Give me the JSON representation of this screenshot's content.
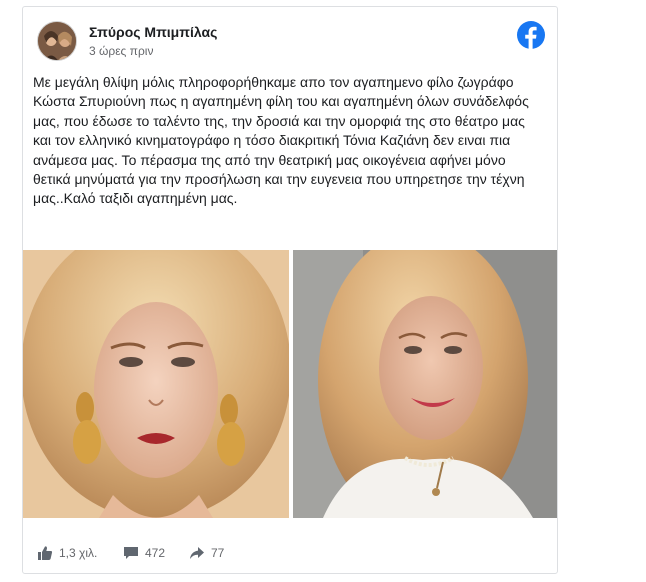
{
  "post": {
    "author": "Σπύρος Μπιμπίλας",
    "timestamp": "3 ώρες πριν",
    "text": "Με μεγάλη θλίψη μόλις πληροφορήθηκαμε απο τον αγαπημενο φίλο ζωγράφο Κώστα Σπυριούνη πως η αγαπημένη φίλη του και αγαπημένη όλων συνάδελφός μας, που έδωσε το ταλέντο της, την δροσιά και την ομορφιά της στο θέατρο μας και τον ελληνικό κινηματογράφο η τόσο διακριτική Τόνια Καζιάνη δεν ειναι πια ανάμεσα μας. Το πέρασμα της από την θεατρική μας οικογένεια αφήνει μόνο θετικά μηνύματά για την προσήλωση και την ευγενεια που υπηρετησε την τέχνη μας..Καλό ταξιδι αγαπημένη μας.",
    "brand_icon": "facebook-icon",
    "brand_color": "#1877f2"
  },
  "stats": {
    "likes": "1,3 χιλ.",
    "comments": "472",
    "shares": "77"
  }
}
